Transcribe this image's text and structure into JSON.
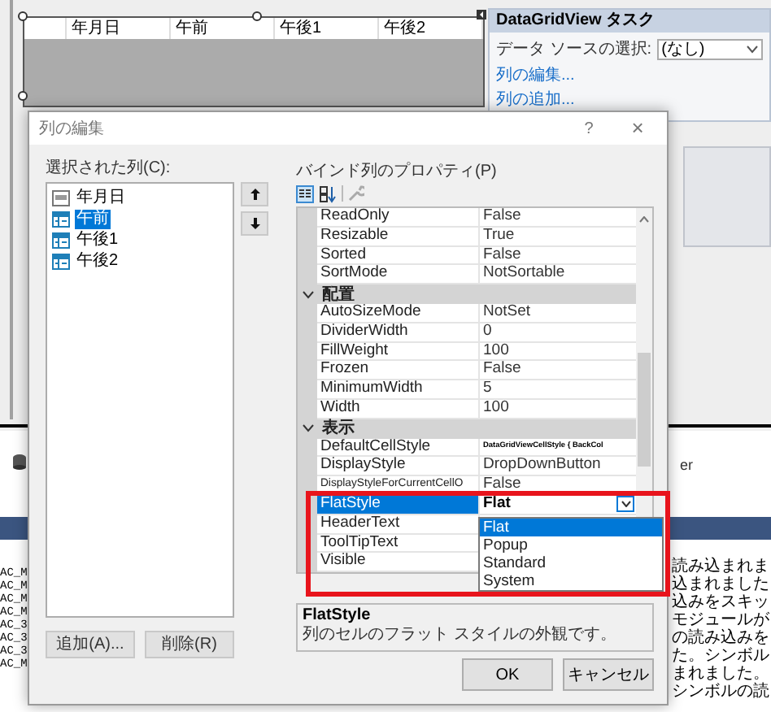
{
  "designer": {
    "grid_columns": [
      "年月日",
      "午前",
      "午後1",
      "午後2"
    ]
  },
  "tasks": {
    "title": "DataGridView タスク",
    "datasource_label": "データ ソースの選択:",
    "datasource_value": "(なし)",
    "links": [
      "列の編集...",
      "列の追加..."
    ]
  },
  "background": {
    "right_fragment": "er",
    "left_lines": [
      "AC_M",
      "AC_M",
      "AC_M",
      "AC_M",
      "AC_3",
      "AC_3",
      "AC_3",
      "AC_M"
    ],
    "right_lines": [
      "読み込まれま",
      "込まれました",
      "込みをスキッ",
      "モジュールが",
      "の読み込みを",
      "た。シンボル",
      "まれました。",
      "シンボルの読"
    ]
  },
  "dialog": {
    "title": "列の編集",
    "help": "?",
    "close": "×",
    "columns_label": "選択された列(C):",
    "columns": [
      {
        "label": "年月日",
        "kind": "textbox",
        "selected": false
      },
      {
        "label": "午前",
        "kind": "combo",
        "selected": true
      },
      {
        "label": "午後1",
        "kind": "combo",
        "selected": false
      },
      {
        "label": "午後2",
        "kind": "combo",
        "selected": false
      }
    ],
    "add_button": "追加(A)...",
    "remove_button": "削除(R)",
    "properties_label": "バインド列のプロパティ(P)",
    "properties": [
      {
        "kind": "property",
        "name": "ReadOnly",
        "value": "False",
        "modified": false,
        "selected": false
      },
      {
        "kind": "property",
        "name": "Resizable",
        "value": "True",
        "modified": false,
        "selected": false
      },
      {
        "kind": "property",
        "name": "Sorted",
        "value": "False",
        "modified": false,
        "selected": false
      },
      {
        "kind": "property",
        "name": "SortMode",
        "value": "NotSortable",
        "modified": false,
        "selected": false
      },
      {
        "kind": "category",
        "name": "配置",
        "expanded": true
      },
      {
        "kind": "property",
        "name": "AutoSizeMode",
        "value": "NotSet",
        "modified": false,
        "selected": false
      },
      {
        "kind": "property",
        "name": "DividerWidth",
        "value": "0",
        "modified": false,
        "selected": false
      },
      {
        "kind": "property",
        "name": "FillWeight",
        "value": "100",
        "modified": false,
        "selected": false
      },
      {
        "kind": "property",
        "name": "Frozen",
        "value": "False",
        "modified": false,
        "selected": false
      },
      {
        "kind": "property",
        "name": "MinimumWidth",
        "value": "5",
        "modified": false,
        "selected": false
      },
      {
        "kind": "property",
        "name": "Width",
        "value": "100",
        "modified": false,
        "selected": false
      },
      {
        "kind": "category",
        "name": "表示",
        "expanded": true
      },
      {
        "kind": "property",
        "name": "DefaultCellStyle",
        "value": "DataGridViewCellStyle { BackCol",
        "modified": true,
        "selected": false
      },
      {
        "kind": "property",
        "name": "DisplayStyle",
        "value": "DropDownButton",
        "modified": false,
        "selected": false
      },
      {
        "kind": "property",
        "name": "DisplayStyleForCurrentCellO",
        "value": "False",
        "modified": false,
        "selected": false
      },
      {
        "kind": "property",
        "name": "FlatStyle",
        "value": "Flat",
        "modified": true,
        "selected": true
      },
      {
        "kind": "property",
        "name": "HeaderText",
        "selected": false
      },
      {
        "kind": "property",
        "name": "ToolTipText",
        "selected": false
      },
      {
        "kind": "property",
        "name": "Visible",
        "selected": false
      }
    ],
    "dropdown_options": [
      {
        "label": "Flat",
        "selected": true
      },
      {
        "label": "Popup",
        "selected": false
      },
      {
        "label": "Standard",
        "selected": false
      },
      {
        "label": "System",
        "selected": false
      }
    ],
    "description_title": "FlatStyle",
    "description_text": "列のセルのフラット スタイルの外観です。",
    "ok": "OK",
    "cancel": "キャンセル"
  }
}
